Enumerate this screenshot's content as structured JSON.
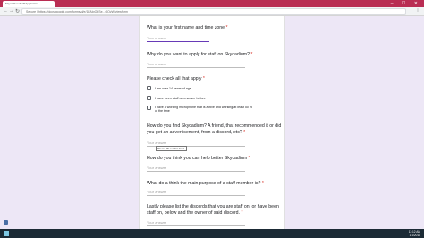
{
  "browser": {
    "tab_title": "Skycadium Staff Application",
    "url": "Secure | https://docs.google.com/forms/d/e/1FAIpQLSe...QQyW/viewform",
    "window_controls": "– ☐ ✕",
    "menu": "⋮"
  },
  "form": {
    "questions": [
      {
        "title": "What is your first name and time zone",
        "required": "*",
        "placeholder": "Your answer"
      },
      {
        "title": "Why do you want to apply for staff on Skycadium?",
        "required": "*",
        "placeholder": "Your answer"
      },
      {
        "title": "Please check all that apply",
        "required": "*"
      },
      {
        "title": "How do you find Skycadium? A friend, that recommended it or did you get an advertisement, from a discord, etc?",
        "required": "*",
        "placeholder": "Your answer"
      },
      {
        "title": "How do you think you can help better Skycadium",
        "required": "*",
        "placeholder": "Your answer"
      },
      {
        "title": "What do a think the main purpose of a staff member is?",
        "required": "*",
        "placeholder": "Your answer"
      },
      {
        "title": "Lastly please list the discords that you are staff on, or have been staff on, below and the owner of said discord.",
        "required": "*",
        "placeholder": "Your answer"
      }
    ],
    "checkboxes": [
      "I am over 14 years of age",
      "I have been staff on a server before",
      "I have a working microphone that is active and working at least 50 % of the time"
    ],
    "tooltip": "Please fill out this field."
  },
  "taskbar": {
    "time": "11:12 AM",
    "date": "1/1/2018"
  }
}
